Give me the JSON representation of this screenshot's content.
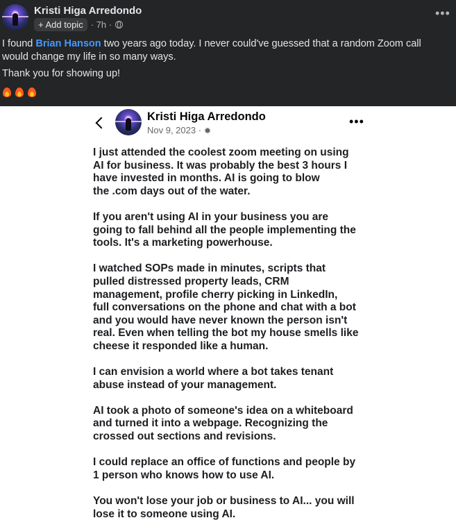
{
  "post": {
    "author": "Kristi Higa Arredondo",
    "add_topic_label": "+ Add topic",
    "time": "· 7h ·",
    "text_before_link": "I found ",
    "link_text": "Brian Hanson",
    "text_after_link": " two years ago today. I never could've guessed that a random Zoom call would change my life in so many ways.",
    "thanks": "Thank you for showing up!",
    "emoji_count": 3,
    "icons": [
      "globe-icon",
      "more-icon",
      "fire-icon"
    ]
  },
  "screenshot": {
    "author": "Kristi Higa Arredondo",
    "date": "Nov 9, 2023 ·",
    "paragraphs": [
      "I just attended the coolest zoom meeting on using\nAI for business. It was probably the best 3 hours I\nhave invested in months. AI is going to blow\nthe .com days out of the water.",
      "If you aren't using AI in your business you are\ngoing to fall behind all the people implementing the\ntools. It's a marketing powerhouse.",
      "I watched SOPs made in minutes, scripts that\npulled distressed property leads, CRM\nmanagement, profile cherry picking in LinkedIn,\nfull conversations on the phone and chat with a bot\nand you would have never known the person isn't\nreal. Even when telling the bot my house smells like\ncheese it responded like a human.",
      "I can envision a world where a bot takes tenant\nabuse instead of your management.",
      "AI took a photo of someone's idea on a whiteboard\nand turned it into a webpage. Recognizing the\ncrossed out sections and revisions.",
      "I could replace an office of functions and people by\n1 person who knows how to use AI.",
      "You won't lose your job or business to AI... you will\nlose it to someone using AI."
    ],
    "icons": [
      "back-icon",
      "gear-icon",
      "more-icon"
    ]
  },
  "colors": {
    "dark_bg": "#242526",
    "link": "#4599ff",
    "text_light": "#e4e6eb",
    "muted": "#b0b3b8"
  }
}
